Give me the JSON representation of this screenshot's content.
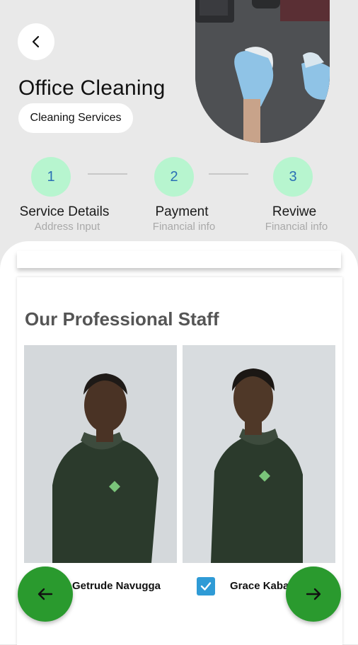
{
  "header": {
    "title": "Office Cleaning",
    "category": "Cleaning Services",
    "back_icon": "chevron-left-icon"
  },
  "steps": [
    {
      "number": "1",
      "title": "Service Details",
      "subtitle": "Address Input"
    },
    {
      "number": "2",
      "title": "Payment",
      "subtitle": "Financial info"
    },
    {
      "number": "3",
      "title": "Reviwe",
      "subtitle": "Financial info"
    }
  ],
  "staff": {
    "title": "Our Professional Staff",
    "members": [
      {
        "name": "Getrude Navugga",
        "selected": false
      },
      {
        "name": "Grace Kaba",
        "selected": true
      }
    ]
  },
  "nav": {
    "prev_icon": "arrow-left-icon",
    "next_icon": "arrow-right-icon"
  },
  "colors": {
    "step_circle": "#b7f5cf",
    "step_number": "#2a6fb5",
    "fab": "#2a9a2e",
    "checkbox": "#2f9bd6",
    "uniform": "#2b3a2c"
  }
}
